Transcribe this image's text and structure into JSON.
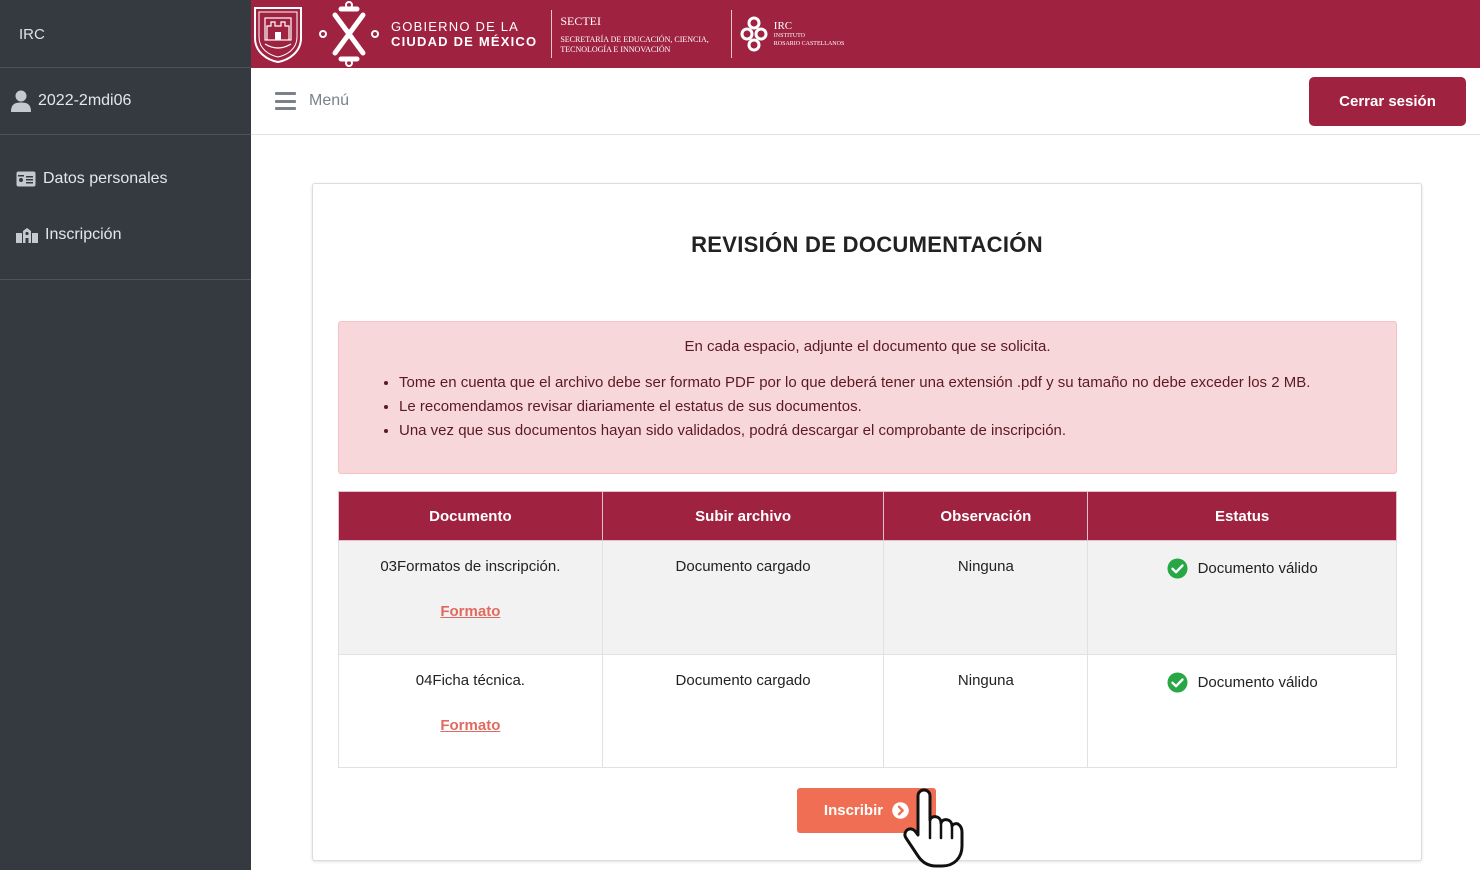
{
  "sidebar": {
    "brand": "IRC",
    "user": "2022-2mdi06",
    "items": [
      {
        "label": "Datos personales",
        "icon": "id-card-icon"
      },
      {
        "label": "Inscripción",
        "icon": "school-icon"
      }
    ]
  },
  "banner": {
    "gov_line1": "GOBIERNO DE LA",
    "gov_line2": "CIUDAD DE MÉXICO",
    "secte_title": "SECTEI",
    "secte_line1": "SECRETARÍA DE EDUCACIÓN, CIENCIA,",
    "secte_line2": "TECNOLOGÍA E INNOVACIÓN",
    "irc_title": "IRC",
    "irc_line1": "INSTITUTO",
    "irc_line2": "ROSARIO CASTELLANOS"
  },
  "topnav": {
    "menu_label": "Menú",
    "logout_label": "Cerrar sesión"
  },
  "main": {
    "title": "REVISIÓN DE DOCUMENTACIÓN",
    "alert": {
      "lead": "En cada espacio, adjunte el documento que se solicita.",
      "bullets": [
        "Tome en cuenta que el archivo debe ser formato PDF por lo que deberá tener una extensión .pdf y su tamaño no debe exceder los 2 MB.",
        "Le recomendamos revisar diariamente el estatus de sus documentos.",
        "Una vez que sus documentos hayan sido validados, podrá descargar el comprobante de inscripción."
      ]
    },
    "table": {
      "headers": [
        "Documento",
        "Subir archivo",
        "Observación",
        "Estatus"
      ],
      "rows": [
        {
          "documento": "03Formatos de inscripción.",
          "link": "Formato",
          "subir": "Documento cargado",
          "observacion": "Ninguna",
          "estatus": "Documento válido"
        },
        {
          "documento": "04Ficha técnica.",
          "link": "Formato",
          "subir": "Documento cargado",
          "observacion": "Ninguna",
          "estatus": "Documento válido"
        }
      ]
    },
    "submit_label": "Inscribir"
  },
  "colors": {
    "brand": "#9f2241",
    "sidebar": "#343a40",
    "alert_bg": "#f8d7da",
    "button": "#f06e53",
    "valid": "#28a745"
  }
}
